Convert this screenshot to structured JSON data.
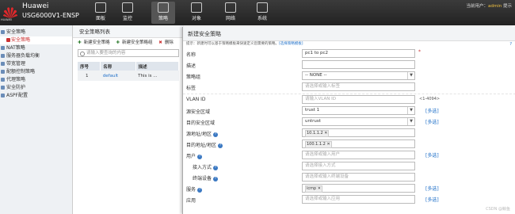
{
  "header": {
    "logo_text": "HUAWEI",
    "brand": "Huawei",
    "model": "USG6000V1-ENSP",
    "nav": [
      "面板",
      "监控",
      "策略",
      "对象",
      "网络",
      "系统"
    ],
    "user_prefix": "当前用户：",
    "user_name": "admin",
    "user_suffix": "提示"
  },
  "sidebar": {
    "items": [
      {
        "label": "安全策略"
      },
      {
        "label": "安全策略"
      },
      {
        "label": "NAT策略"
      },
      {
        "label": "服务器负载均衡"
      },
      {
        "label": "带宽管理"
      },
      {
        "label": "配额控制策略"
      },
      {
        "label": "代理策略"
      },
      {
        "label": "安全防护"
      },
      {
        "label": "ASPF配置"
      }
    ]
  },
  "list": {
    "title": "安全策略列表",
    "tool_new": "新建安全策略",
    "tool_new_group": "新建安全策略组",
    "tool_delete": "删除",
    "search_placeholder": "请输入要查询的内容",
    "columns": [
      "序号",
      "名称",
      "描述"
    ],
    "rows": [
      {
        "index": "1",
        "name": "default",
        "desc": "This is ..."
      }
    ]
  },
  "dialog": {
    "title": "新建安全策略",
    "tip": "提示：新建时可以基于策略模板来快速定义您需要的策略。",
    "tip_link": "[选择策略模板]",
    "help": "?",
    "fields": {
      "name_label": "名称",
      "name_value": "pc1 to pc2",
      "name_required": "*",
      "desc_label": "描述",
      "group_label": "策略组",
      "group_value": "-- NONE --",
      "tag_label": "标签",
      "tag_placeholder": "请选择或输入标签",
      "vlan_label": "VLAN ID",
      "vlan_placeholder": "请输入VLAN ID",
      "vlan_hint": "<1-4094>",
      "src_zone_label": "源安全区域",
      "src_zone_value": "trust 1",
      "dst_zone_label": "目的安全区域",
      "dst_zone_value": "untrust",
      "src_addr_label": "源地址/地区",
      "src_addr_value": "10.1.1.2",
      "dst_addr_label": "目的地址/地区",
      "dst_addr_value": "100.1.1.2",
      "user_label": "用户",
      "user_placeholder": "请选择或输入用户",
      "access_label": "接入方式",
      "access_placeholder": "请选择接入方式",
      "terminal_label": "终端设备",
      "terminal_placeholder": "请选择或输入终端设备",
      "service_label": "服务",
      "service_value": "icmp",
      "app_label": "应用",
      "app_placeholder": "请选择或输入应用",
      "more": "[多选]"
    }
  },
  "watermark": "CSDN @鲸鱼"
}
